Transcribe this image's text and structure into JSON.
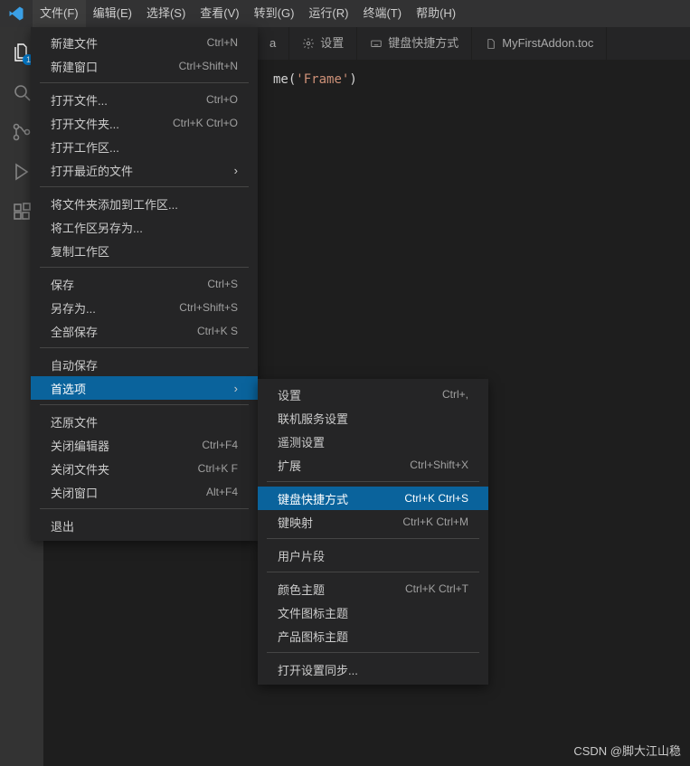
{
  "menubar": {
    "items": [
      "文件(F)",
      "编辑(E)",
      "选择(S)",
      "查看(V)",
      "转到(G)",
      "运行(R)",
      "终端(T)",
      "帮助(H)"
    ]
  },
  "activitybar": {
    "explorer_badge": "1"
  },
  "tabs": {
    "t0_suffix": "a",
    "t1": "设置",
    "t2": "键盘快捷方式",
    "t3": "MyFirstAddon.toc"
  },
  "code": {
    "fn_suffix": "me",
    "open": "(",
    "arg": "'Frame'",
    "close": ")"
  },
  "file_menu": {
    "new_file": {
      "label": "新建文件",
      "shortcut": "Ctrl+N"
    },
    "new_window": {
      "label": "新建窗口",
      "shortcut": "Ctrl+Shift+N"
    },
    "open_file": {
      "label": "打开文件...",
      "shortcut": "Ctrl+O"
    },
    "open_folder": {
      "label": "打开文件夹...",
      "shortcut": "Ctrl+K Ctrl+O"
    },
    "open_ws": {
      "label": "打开工作区...",
      "shortcut": ""
    },
    "open_recent": {
      "label": "打开最近的文件",
      "shortcut": ""
    },
    "add_folder": {
      "label": "将文件夹添加到工作区...",
      "shortcut": ""
    },
    "save_ws_as": {
      "label": "将工作区另存为...",
      "shortcut": ""
    },
    "dup_ws": {
      "label": "复制工作区",
      "shortcut": ""
    },
    "save": {
      "label": "保存",
      "shortcut": "Ctrl+S"
    },
    "save_as": {
      "label": "另存为...",
      "shortcut": "Ctrl+Shift+S"
    },
    "save_all": {
      "label": "全部保存",
      "shortcut": "Ctrl+K S"
    },
    "auto_save": {
      "label": "自动保存",
      "shortcut": ""
    },
    "preferences": {
      "label": "首选项",
      "shortcut": ""
    },
    "revert": {
      "label": "还原文件",
      "shortcut": ""
    },
    "close_editor": {
      "label": "关闭编辑器",
      "shortcut": "Ctrl+F4"
    },
    "close_folder": {
      "label": "关闭文件夹",
      "shortcut": "Ctrl+K F"
    },
    "close_window": {
      "label": "关闭窗口",
      "shortcut": "Alt+F4"
    },
    "exit": {
      "label": "退出",
      "shortcut": ""
    }
  },
  "pref_menu": {
    "settings": {
      "label": "设置",
      "shortcut": "Ctrl+,"
    },
    "online": {
      "label": "联机服务设置",
      "shortcut": ""
    },
    "telemetry": {
      "label": "遥测设置",
      "shortcut": ""
    },
    "extensions": {
      "label": "扩展",
      "shortcut": "Ctrl+Shift+X"
    },
    "kbd": {
      "label": "键盘快捷方式",
      "shortcut": "Ctrl+K Ctrl+S"
    },
    "keymaps": {
      "label": "键映射",
      "shortcut": "Ctrl+K Ctrl+M"
    },
    "snippets": {
      "label": "用户片段",
      "shortcut": ""
    },
    "color_theme": {
      "label": "颜色主题",
      "shortcut": "Ctrl+K Ctrl+T"
    },
    "file_icon": {
      "label": "文件图标主题",
      "shortcut": ""
    },
    "product_icon": {
      "label": "产品图标主题",
      "shortcut": ""
    },
    "sync": {
      "label": "打开设置同步...",
      "shortcut": ""
    }
  },
  "watermark": "CSDN @脚大江山稳"
}
